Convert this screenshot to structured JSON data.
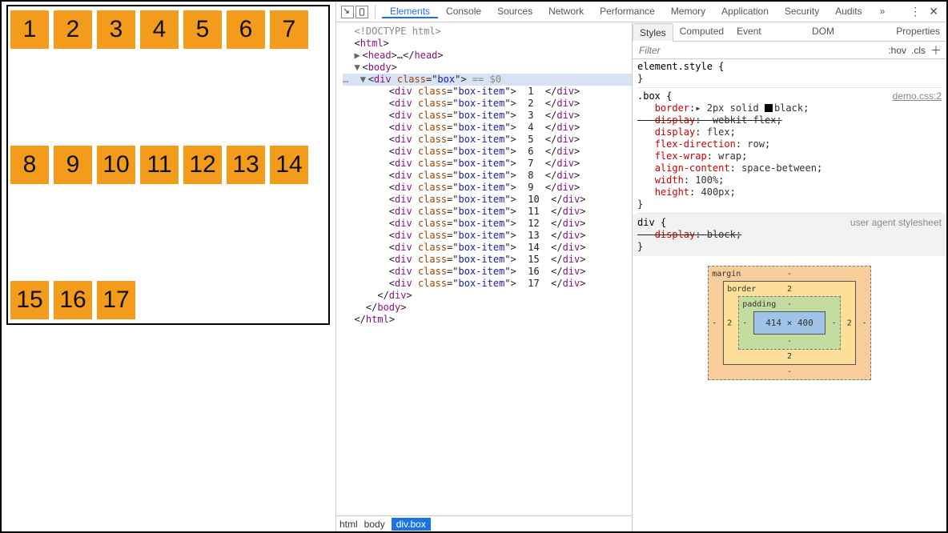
{
  "page": {
    "box_items": [
      "1",
      "2",
      "3",
      "4",
      "5",
      "6",
      "7",
      "8",
      "9",
      "10",
      "11",
      "12",
      "13",
      "14",
      "15",
      "16",
      "17"
    ]
  },
  "toolbar": {
    "tabs": [
      "Elements",
      "Console",
      "Sources",
      "Network",
      "Performance",
      "Memory",
      "Application",
      "Security",
      "Audits"
    ],
    "active_tab": "Elements",
    "more": "»",
    "menu": "⋮",
    "close": "✕"
  },
  "tree": {
    "doctype": "<!DOCTYPE html>",
    "html_open": "html",
    "head": "head",
    "body": "body",
    "box_class": "box",
    "item_class": "box-item",
    "selected_hint": "== $0",
    "items": [
      "1",
      "2",
      "3",
      "4",
      "5",
      "6",
      "7",
      "8",
      "9",
      "10",
      "11",
      "12",
      "13",
      "14",
      "15",
      "16",
      "17"
    ]
  },
  "crumb": {
    "a": "html",
    "b": "body",
    "c": "div.box"
  },
  "styles": {
    "tabs": [
      "Styles",
      "Computed",
      "Event Listeners",
      "DOM Breakpoints",
      "Properties"
    ],
    "filter_placeholder": "Filter",
    "hov": ":hov",
    "cls": ".cls",
    "element_style": "element.style {",
    "close_brace": "}",
    "box_selector": ".box {",
    "box_source": "demo.css:2",
    "rules": {
      "border_k": "border",
      "border_v": "▸ 2px solid ",
      "border_color": "black",
      "display1_k": "display",
      "display1_v": "-webkit-flex",
      "display2_k": "display",
      "display2_v": "flex",
      "flexdir_k": "flex-direction",
      "flexdir_v": "row",
      "wrap_k": "flex-wrap",
      "wrap_v": "wrap",
      "align_k": "align-content",
      "align_v": "space-between",
      "width_k": "width",
      "width_v": "100%",
      "height_k": "height",
      "height_v": "400px"
    },
    "ua": {
      "sel": "div {",
      "src": "user agent stylesheet",
      "rule_k": "display",
      "rule_v": "block"
    }
  },
  "boxmodel": {
    "margin_label": "margin",
    "margin_t": "-",
    "margin_r": "-",
    "margin_b": "-",
    "margin_l": "-",
    "border_label": "border",
    "border_t": "2",
    "border_r": "2",
    "border_b": "2",
    "border_l": "2",
    "padding_label": "padding",
    "padding_t": "-",
    "padding_r": "-",
    "padding_b": "-",
    "padding_l": "-",
    "content": "414 × 400"
  }
}
